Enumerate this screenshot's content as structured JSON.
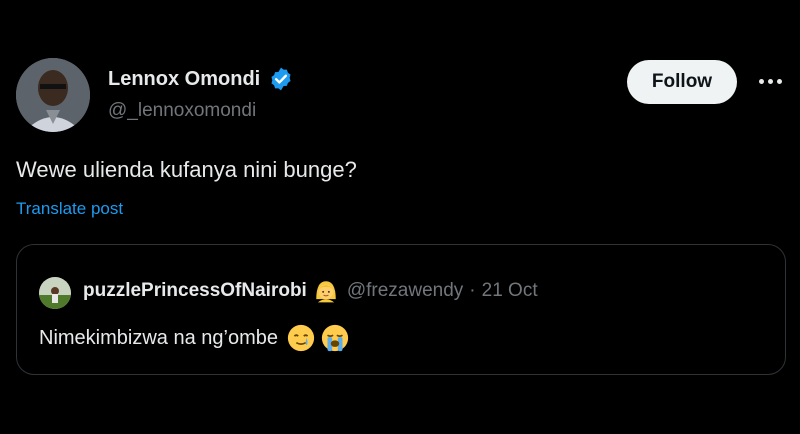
{
  "post": {
    "author_name": "Lennox Omondi",
    "author_handle": "@_lennoxomondi",
    "follow_label": "Follow",
    "text": "Wewe ulienda kufanya nini bunge?",
    "translate_label": "Translate post"
  },
  "quoted_post": {
    "author_name": "puzzlePrincessOfNairobi",
    "author_handle": "@frezawendy",
    "separator": "·",
    "date": "21 Oct",
    "text": "Nimekimbizwa na ng’ombe"
  },
  "icons": {
    "verified": "verified-badge-icon",
    "more": "more-options-icon",
    "name_emoji": "blonde-person-emoji-icon",
    "text_emojis": [
      "crying-smile-emoji-icon",
      "loudly-crying-emoji-icon"
    ]
  },
  "colors": {
    "background": "#000000",
    "text": "#e7e9ea",
    "secondary": "#71767b",
    "link": "#1d9bf0",
    "follow_bg": "#eff3f4",
    "border": "#2f3336"
  }
}
